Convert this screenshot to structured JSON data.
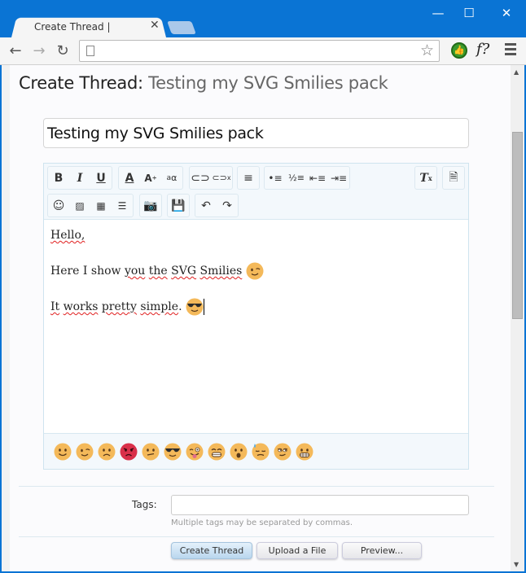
{
  "browser": {
    "tab_title": "Create Thread |",
    "url": "",
    "window_controls": {
      "minimize": "—",
      "maximize": "☐",
      "close": "✕"
    }
  },
  "page": {
    "title_prefix": "Create Thread:",
    "title_subject": "Testing my SVG Smilies pack",
    "thread_title_value": "Testing my SVG Smilies pack"
  },
  "editor": {
    "toolbar_row1": [
      {
        "group": [
          "bold",
          "italic",
          "underline"
        ]
      },
      {
        "group": [
          "font-color",
          "font-size",
          "font-family"
        ]
      },
      {
        "group": [
          "link",
          "unlink"
        ]
      },
      {
        "group": [
          "align"
        ]
      },
      {
        "group": [
          "bullet-list",
          "numbered-list",
          "outdent",
          "indent"
        ]
      },
      {
        "group": [
          "remove-format"
        ]
      },
      {
        "group": [
          "bbcode-toggle"
        ]
      }
    ],
    "toolbar_row2": [
      {
        "group": [
          "smilies",
          "image",
          "media",
          "insert-text"
        ]
      },
      {
        "group": [
          "camera"
        ]
      },
      {
        "group": [
          "save-draft"
        ]
      },
      {
        "group": [
          "undo",
          "redo"
        ]
      }
    ],
    "lines": [
      {
        "text": "Hello,",
        "smilie": null
      },
      {
        "text_parts": [
          "Here I show ",
          "you",
          " ",
          "the",
          " ",
          "SVG",
          " ",
          "Smilies"
        ],
        "smilie": "wink"
      },
      {
        "text_parts": [
          "It",
          " ",
          "works",
          " ",
          "pretty",
          " ",
          "simple",
          "."
        ],
        "smilie": "cool"
      }
    ],
    "smilies": [
      "smile",
      "wink",
      "frown",
      "mad",
      "confused",
      "cool",
      "tongue",
      "grin",
      "oh",
      "sweat",
      "roll-eyes",
      "grimace"
    ]
  },
  "tags": {
    "label": "Tags:",
    "value": "",
    "hint": "Multiple tags may be separated by commas."
  },
  "buttons": {
    "create": "Create Thread",
    "upload": "Upload a File",
    "preview": "Preview..."
  },
  "colors": {
    "chrome_blue": "#0a74d4",
    "smilie_yellow": "#f4b95a",
    "smilie_red": "#d9304a"
  }
}
